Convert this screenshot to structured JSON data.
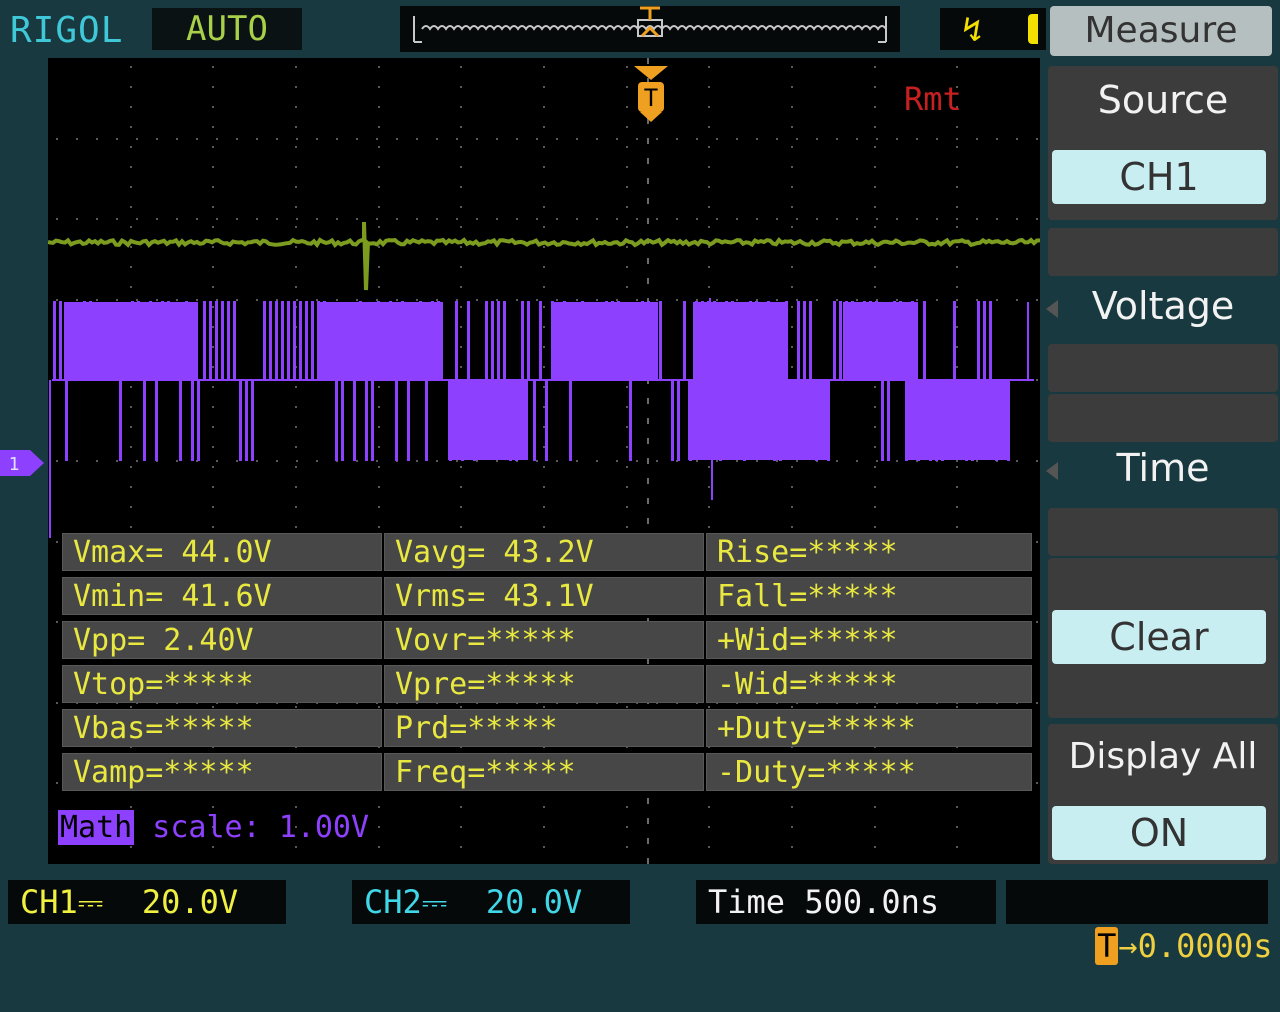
{
  "brand": "RIGOL",
  "mode": "AUTO",
  "rmt": "Rmt",
  "trigger_marker_label": "T",
  "channel_marker_label": "1",
  "menu": {
    "title": "Measure",
    "items": [
      {
        "label": "Source",
        "value": "CH1"
      },
      {
        "label": "Voltage"
      },
      {
        "label": "Time"
      },
      {
        "label": "",
        "value": "Clear"
      },
      {
        "label": "Display All",
        "value": "ON"
      }
    ]
  },
  "measurements": {
    "col1": [
      "Vmax= 44.0V",
      "Vmin= 41.6V",
      "Vpp= 2.40V",
      "Vtop=*****",
      "Vbas=*****",
      "Vamp=*****"
    ],
    "col2": [
      "Vavg= 43.2V",
      "Vrms= 43.1V",
      "Vovr=*****",
      "Vpre=*****",
      "Prd=*****",
      "Freq=*****"
    ],
    "col3": [
      "Rise=*****",
      "Fall=*****",
      "+Wid=*****",
      "-Wid=*****",
      "+Duty=*****",
      "-Duty=*****"
    ]
  },
  "math": {
    "tag": "Math",
    "scale": " scale:  1.00V"
  },
  "status": {
    "ch1": "CH1⎓  20.0V",
    "ch2": "CH2⎓  20.0V",
    "time": "Time 500.0ns",
    "trigger_tag": "T",
    "trigger_offset": "→0.0000s"
  },
  "colors": {
    "background": "#17393f",
    "screen": "#000000",
    "ch1_trace": "#8e40ff",
    "ch2_trace": "#7c9c20",
    "trigger": "#f0a020",
    "measure_text": "#e8e840"
  }
}
